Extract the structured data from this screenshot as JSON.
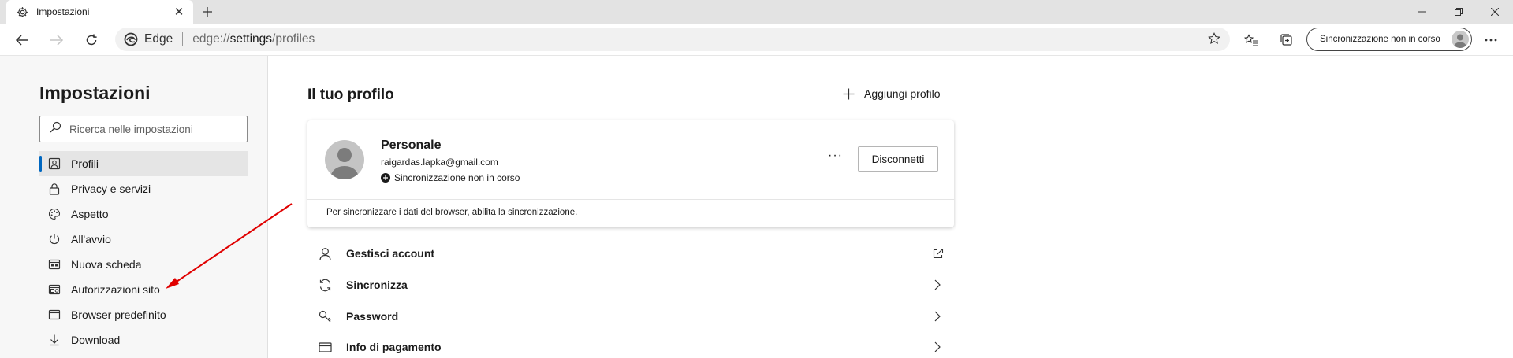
{
  "tab": {
    "title": "Impostazioni"
  },
  "address": {
    "edge_label": "Edge",
    "url_prefix": "edge://",
    "url_bold": "settings",
    "url_suffix": "/profiles"
  },
  "toolbar": {
    "sync_pill": "Sincronizzazione non in corso"
  },
  "sidebar": {
    "title": "Impostazioni",
    "search_placeholder": "Ricerca nelle impostazioni",
    "items": [
      {
        "label": "Profili",
        "icon": "profile-icon",
        "active": true
      },
      {
        "label": "Privacy e servizi",
        "icon": "lock-icon"
      },
      {
        "label": "Aspetto",
        "icon": "palette-icon"
      },
      {
        "label": "All'avvio",
        "icon": "power-icon"
      },
      {
        "label": "Nuova scheda",
        "icon": "new-tab-icon"
      },
      {
        "label": "Autorizzazioni sito",
        "icon": "site-permissions-icon"
      },
      {
        "label": "Browser predefinito",
        "icon": "browser-icon"
      },
      {
        "label": "Download",
        "icon": "download-icon"
      }
    ]
  },
  "main": {
    "title": "Il tuo profilo",
    "add_profile": "Aggiungi profilo",
    "profile": {
      "name": "Personale",
      "email": "raigardas.lapka@gmail.com",
      "status": "Sincronizzazione non in corso",
      "more": "···",
      "disconnect": "Disconnetti",
      "note": "Per sincronizzare i dati del browser, abilita la sincronizzazione."
    },
    "rows": [
      {
        "label": "Gestisci account",
        "icon": "person-icon",
        "trail": "external-link-icon"
      },
      {
        "label": "Sincronizza",
        "icon": "sync-icon",
        "trail": "chevron-right-icon"
      },
      {
        "label": "Password",
        "icon": "key-icon",
        "trail": "chevron-right-icon"
      },
      {
        "label": "Info di pagamento",
        "icon": "card-icon",
        "trail": "chevron-right-icon"
      }
    ]
  },
  "colors": {
    "accent": "#0067c0",
    "annotation_arrow": "#e00000"
  }
}
